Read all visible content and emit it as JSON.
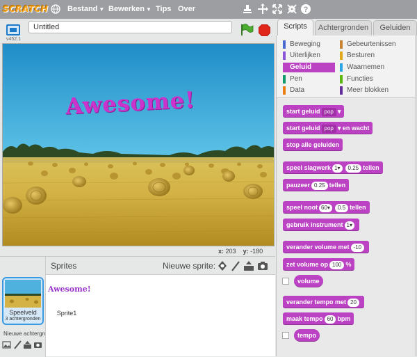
{
  "menubar": {
    "logo": "SCRATCH",
    "menus": [
      {
        "label": "Bestand",
        "has_arrow": true
      },
      {
        "label": "Bewerken",
        "has_arrow": true
      },
      {
        "label": "Tips",
        "has_arrow": false
      },
      {
        "label": "Over",
        "has_arrow": false
      }
    ],
    "tools": [
      "stamp-icon",
      "scissors-icon",
      "grow-icon",
      "shrink-icon",
      "help-icon"
    ]
  },
  "stage_header": {
    "version": "v452.1",
    "title_value": "Untitled"
  },
  "stage": {
    "sprite_text": "Awesome!",
    "coords": {
      "x_label": "x:",
      "x_value": "203",
      "y_label": "y:",
      "y_value": "-180"
    }
  },
  "sprites_pane": {
    "title": "Sprites",
    "new_sprite_label": "Nieuwe sprite:",
    "stage_thumb": {
      "name": "Speelveld",
      "sub": "3 achtergronden"
    },
    "new_backdrop_label": "Nieuwe achtergrond:",
    "sprites": [
      {
        "name": "Sprite1",
        "thumb_text": "Awesome!"
      }
    ]
  },
  "tabs": [
    {
      "label": "Scripts",
      "active": true
    },
    {
      "label": "Achtergronden",
      "active": false
    },
    {
      "label": "Geluiden",
      "active": false
    }
  ],
  "categories": {
    "left": [
      {
        "label": "Beweging",
        "color": "#4a6cd4"
      },
      {
        "label": "Uiterlijken",
        "color": "#8a55d7"
      },
      {
        "label": "Geluid",
        "color": "#bb42c3",
        "selected": true
      },
      {
        "label": "Pen",
        "color": "#0e9a6c"
      },
      {
        "label": "Data",
        "color": "#ee7d16"
      }
    ],
    "right": [
      {
        "label": "Gebeurtenissen",
        "color": "#c88330"
      },
      {
        "label": "Besturen",
        "color": "#e1a91a"
      },
      {
        "label": "Waarnemen",
        "color": "#2ca5e2"
      },
      {
        "label": "Functies",
        "color": "#5cb712"
      },
      {
        "label": "Meer blokken",
        "color": "#632d99"
      }
    ]
  },
  "blocks": {
    "b1": {
      "pre": "start geluid",
      "dd": "pop"
    },
    "b2": {
      "pre": "start geluid",
      "dd": "pop",
      "post": "en wacht"
    },
    "b3": {
      "text": "stop alle geluiden"
    },
    "b4": {
      "pre": "speel slagwerk",
      "dd": "1",
      "slot": "0.25",
      "post": "tellen"
    },
    "b5": {
      "pre": "pauzeer",
      "slot": "0.25",
      "post": "tellen"
    },
    "b6": {
      "pre": "speel noot",
      "dd": "60",
      "slot": "0.5",
      "post": "tellen"
    },
    "b7": {
      "pre": "gebruik instrument",
      "dd": "1"
    },
    "b8": {
      "pre": "verander volume met",
      "slot": "-10"
    },
    "b9": {
      "pre": "zet volume op",
      "slot": "100",
      "post": "%"
    },
    "b10": {
      "text": "volume"
    },
    "b11": {
      "pre": "verander tempo met",
      "slot": "20"
    },
    "b12": {
      "pre": "maak tempo",
      "slot": "60",
      "post": "bpm"
    },
    "b13": {
      "text": "tempo"
    }
  },
  "colors": {
    "menubar": "#9c9ea2",
    "sound_block": "#bb42c3",
    "selection": "#3a9ae1"
  }
}
